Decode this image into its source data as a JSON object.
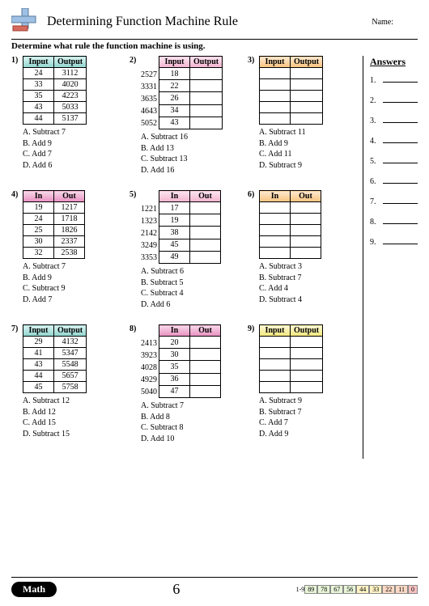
{
  "header": {
    "title": "Determining Function Machine Rule",
    "name_label": "Name:"
  },
  "instruction": "Determine what rule the function machine is using.",
  "answers_panel": {
    "title": "Answers",
    "count": 9
  },
  "chart_data": [
    {
      "number": "1)",
      "headers": [
        "Input",
        "Output"
      ],
      "gradient": "teal",
      "side_labels": null,
      "rows": [
        [
          "24",
          "3112"
        ],
        [
          "33",
          "4020"
        ],
        [
          "35",
          "4223"
        ],
        [
          "43",
          "5033"
        ],
        [
          "44",
          "5137"
        ]
      ],
      "choices": [
        "A. Subtract 7",
        "B. Add 9",
        "C. Add 7",
        "D. Add 6"
      ]
    },
    {
      "number": "2)",
      "headers": [
        "Input",
        "Output"
      ],
      "gradient": "pink",
      "side_labels": [
        "2527",
        "3331",
        "3635",
        "4643",
        "5052"
      ],
      "rows": [
        [
          "18",
          ""
        ],
        [
          "22",
          ""
        ],
        [
          "26",
          ""
        ],
        [
          "34",
          ""
        ],
        [
          "43",
          ""
        ]
      ],
      "choices": [
        "A. Subtract 16",
        "B. Add 13",
        "C. Subtract 13",
        "D. Add 16"
      ]
    },
    {
      "number": "3)",
      "headers": [
        "Input",
        "Output"
      ],
      "gradient": "orange",
      "side_labels": null,
      "rows": [
        [
          "",
          ""
        ],
        [
          "",
          ""
        ],
        [
          "",
          ""
        ],
        [
          "",
          ""
        ],
        [
          "",
          ""
        ]
      ],
      "choices": [
        "A. Subtract 11",
        "B. Add 9",
        "C. Add 11",
        "D. Subtract 9"
      ]
    },
    {
      "number": "4)",
      "headers": [
        "In",
        "Out"
      ],
      "gradient": "magenta",
      "side_labels": null,
      "rows": [
        [
          "19",
          "1217"
        ],
        [
          "24",
          "1718"
        ],
        [
          "25",
          "1826"
        ],
        [
          "30",
          "2337"
        ],
        [
          "32",
          "2538"
        ]
      ],
      "choices": [
        "A. Subtract 7",
        "B. Add 9",
        "C. Subtract 9",
        "D. Add 7"
      ]
    },
    {
      "number": "5)",
      "headers": [
        "In",
        "Out"
      ],
      "gradient": "pink",
      "side_labels": [
        "1221",
        "1323",
        "2142",
        "3249",
        "3353"
      ],
      "rows": [
        [
          "17",
          ""
        ],
        [
          "19",
          ""
        ],
        [
          "38",
          ""
        ],
        [
          "45",
          ""
        ],
        [
          "49",
          ""
        ]
      ],
      "choices": [
        "A. Subtract 6",
        "B. Subtract 5",
        "C. Subtract 4",
        "D. Add 6"
      ]
    },
    {
      "number": "6)",
      "headers": [
        "In",
        "Out"
      ],
      "gradient": "orange",
      "side_labels": null,
      "rows": [
        [
          "",
          ""
        ],
        [
          "",
          ""
        ],
        [
          "",
          ""
        ],
        [
          "",
          ""
        ],
        [
          "",
          ""
        ]
      ],
      "choices": [
        "A. Subtract 3",
        "B. Subtract 7",
        "C. Add 4",
        "D. Subtract 4"
      ]
    },
    {
      "number": "7)",
      "headers": [
        "Input",
        "Output"
      ],
      "gradient": "teal",
      "side_labels": null,
      "rows": [
        [
          "29",
          "4132"
        ],
        [
          "41",
          "5347"
        ],
        [
          "43",
          "5548"
        ],
        [
          "44",
          "5657"
        ],
        [
          "45",
          "5758"
        ]
      ],
      "choices": [
        "A. Subtract 12",
        "B. Add 12",
        "C. Add 15",
        "D. Subtract 15"
      ]
    },
    {
      "number": "8)",
      "headers": [
        "In",
        "Out"
      ],
      "gradient": "magenta",
      "side_labels": [
        "2413",
        "3923",
        "4028",
        "4929",
        "5040"
      ],
      "rows": [
        [
          "20",
          ""
        ],
        [
          "30",
          ""
        ],
        [
          "35",
          ""
        ],
        [
          "36",
          ""
        ],
        [
          "47",
          ""
        ]
      ],
      "choices": [
        "A. Subtract 7",
        "B. Add 8",
        "C. Subtract 8",
        "D. Add 10"
      ]
    },
    {
      "number": "9)",
      "headers": [
        "Input",
        "Output"
      ],
      "gradient": "yellow",
      "side_labels": null,
      "rows": [
        [
          "",
          ""
        ],
        [
          "",
          ""
        ],
        [
          "",
          ""
        ],
        [
          "",
          ""
        ],
        [
          "",
          ""
        ]
      ],
      "choices": [
        "A. Subtract 9",
        "B. Subtract 7",
        "C. Add 7",
        "D. Add 9"
      ]
    }
  ],
  "footer": {
    "badge": "Math",
    "page_number": "6",
    "scale_prefix": "1-9",
    "scale_segments": [
      "89",
      "78",
      "67",
      "56",
      "44",
      "33",
      "22",
      "11",
      "0"
    ]
  }
}
